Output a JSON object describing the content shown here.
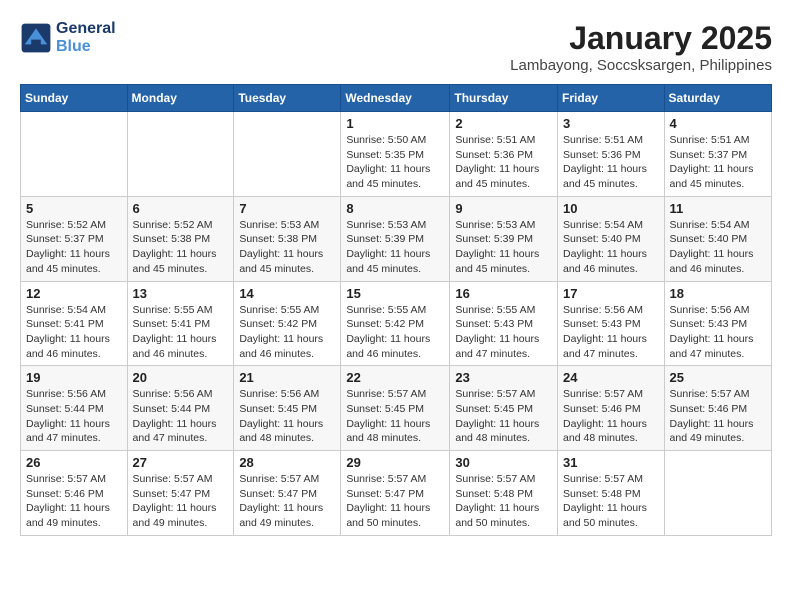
{
  "header": {
    "logo_line1": "General",
    "logo_line2": "Blue",
    "title": "January 2025",
    "subtitle": "Lambayong, Soccsksargen, Philippines"
  },
  "weekdays": [
    "Sunday",
    "Monday",
    "Tuesday",
    "Wednesday",
    "Thursday",
    "Friday",
    "Saturday"
  ],
  "weeks": [
    [
      {
        "day": "",
        "info": ""
      },
      {
        "day": "",
        "info": ""
      },
      {
        "day": "",
        "info": ""
      },
      {
        "day": "1",
        "info": "Sunrise: 5:50 AM\nSunset: 5:35 PM\nDaylight: 11 hours and 45 minutes."
      },
      {
        "day": "2",
        "info": "Sunrise: 5:51 AM\nSunset: 5:36 PM\nDaylight: 11 hours and 45 minutes."
      },
      {
        "day": "3",
        "info": "Sunrise: 5:51 AM\nSunset: 5:36 PM\nDaylight: 11 hours and 45 minutes."
      },
      {
        "day": "4",
        "info": "Sunrise: 5:51 AM\nSunset: 5:37 PM\nDaylight: 11 hours and 45 minutes."
      }
    ],
    [
      {
        "day": "5",
        "info": "Sunrise: 5:52 AM\nSunset: 5:37 PM\nDaylight: 11 hours and 45 minutes."
      },
      {
        "day": "6",
        "info": "Sunrise: 5:52 AM\nSunset: 5:38 PM\nDaylight: 11 hours and 45 minutes."
      },
      {
        "day": "7",
        "info": "Sunrise: 5:53 AM\nSunset: 5:38 PM\nDaylight: 11 hours and 45 minutes."
      },
      {
        "day": "8",
        "info": "Sunrise: 5:53 AM\nSunset: 5:39 PM\nDaylight: 11 hours and 45 minutes."
      },
      {
        "day": "9",
        "info": "Sunrise: 5:53 AM\nSunset: 5:39 PM\nDaylight: 11 hours and 45 minutes."
      },
      {
        "day": "10",
        "info": "Sunrise: 5:54 AM\nSunset: 5:40 PM\nDaylight: 11 hours and 46 minutes."
      },
      {
        "day": "11",
        "info": "Sunrise: 5:54 AM\nSunset: 5:40 PM\nDaylight: 11 hours and 46 minutes."
      }
    ],
    [
      {
        "day": "12",
        "info": "Sunrise: 5:54 AM\nSunset: 5:41 PM\nDaylight: 11 hours and 46 minutes."
      },
      {
        "day": "13",
        "info": "Sunrise: 5:55 AM\nSunset: 5:41 PM\nDaylight: 11 hours and 46 minutes."
      },
      {
        "day": "14",
        "info": "Sunrise: 5:55 AM\nSunset: 5:42 PM\nDaylight: 11 hours and 46 minutes."
      },
      {
        "day": "15",
        "info": "Sunrise: 5:55 AM\nSunset: 5:42 PM\nDaylight: 11 hours and 46 minutes."
      },
      {
        "day": "16",
        "info": "Sunrise: 5:55 AM\nSunset: 5:43 PM\nDaylight: 11 hours and 47 minutes."
      },
      {
        "day": "17",
        "info": "Sunrise: 5:56 AM\nSunset: 5:43 PM\nDaylight: 11 hours and 47 minutes."
      },
      {
        "day": "18",
        "info": "Sunrise: 5:56 AM\nSunset: 5:43 PM\nDaylight: 11 hours and 47 minutes."
      }
    ],
    [
      {
        "day": "19",
        "info": "Sunrise: 5:56 AM\nSunset: 5:44 PM\nDaylight: 11 hours and 47 minutes."
      },
      {
        "day": "20",
        "info": "Sunrise: 5:56 AM\nSunset: 5:44 PM\nDaylight: 11 hours and 47 minutes."
      },
      {
        "day": "21",
        "info": "Sunrise: 5:56 AM\nSunset: 5:45 PM\nDaylight: 11 hours and 48 minutes."
      },
      {
        "day": "22",
        "info": "Sunrise: 5:57 AM\nSunset: 5:45 PM\nDaylight: 11 hours and 48 minutes."
      },
      {
        "day": "23",
        "info": "Sunrise: 5:57 AM\nSunset: 5:45 PM\nDaylight: 11 hours and 48 minutes."
      },
      {
        "day": "24",
        "info": "Sunrise: 5:57 AM\nSunset: 5:46 PM\nDaylight: 11 hours and 48 minutes."
      },
      {
        "day": "25",
        "info": "Sunrise: 5:57 AM\nSunset: 5:46 PM\nDaylight: 11 hours and 49 minutes."
      }
    ],
    [
      {
        "day": "26",
        "info": "Sunrise: 5:57 AM\nSunset: 5:46 PM\nDaylight: 11 hours and 49 minutes."
      },
      {
        "day": "27",
        "info": "Sunrise: 5:57 AM\nSunset: 5:47 PM\nDaylight: 11 hours and 49 minutes."
      },
      {
        "day": "28",
        "info": "Sunrise: 5:57 AM\nSunset: 5:47 PM\nDaylight: 11 hours and 49 minutes."
      },
      {
        "day": "29",
        "info": "Sunrise: 5:57 AM\nSunset: 5:47 PM\nDaylight: 11 hours and 50 minutes."
      },
      {
        "day": "30",
        "info": "Sunrise: 5:57 AM\nSunset: 5:48 PM\nDaylight: 11 hours and 50 minutes."
      },
      {
        "day": "31",
        "info": "Sunrise: 5:57 AM\nSunset: 5:48 PM\nDaylight: 11 hours and 50 minutes."
      },
      {
        "day": "",
        "info": ""
      }
    ]
  ],
  "colors": {
    "header_bg": "#2563a8",
    "header_text": "#ffffff",
    "title_text": "#222222",
    "subtitle_text": "#444444"
  }
}
